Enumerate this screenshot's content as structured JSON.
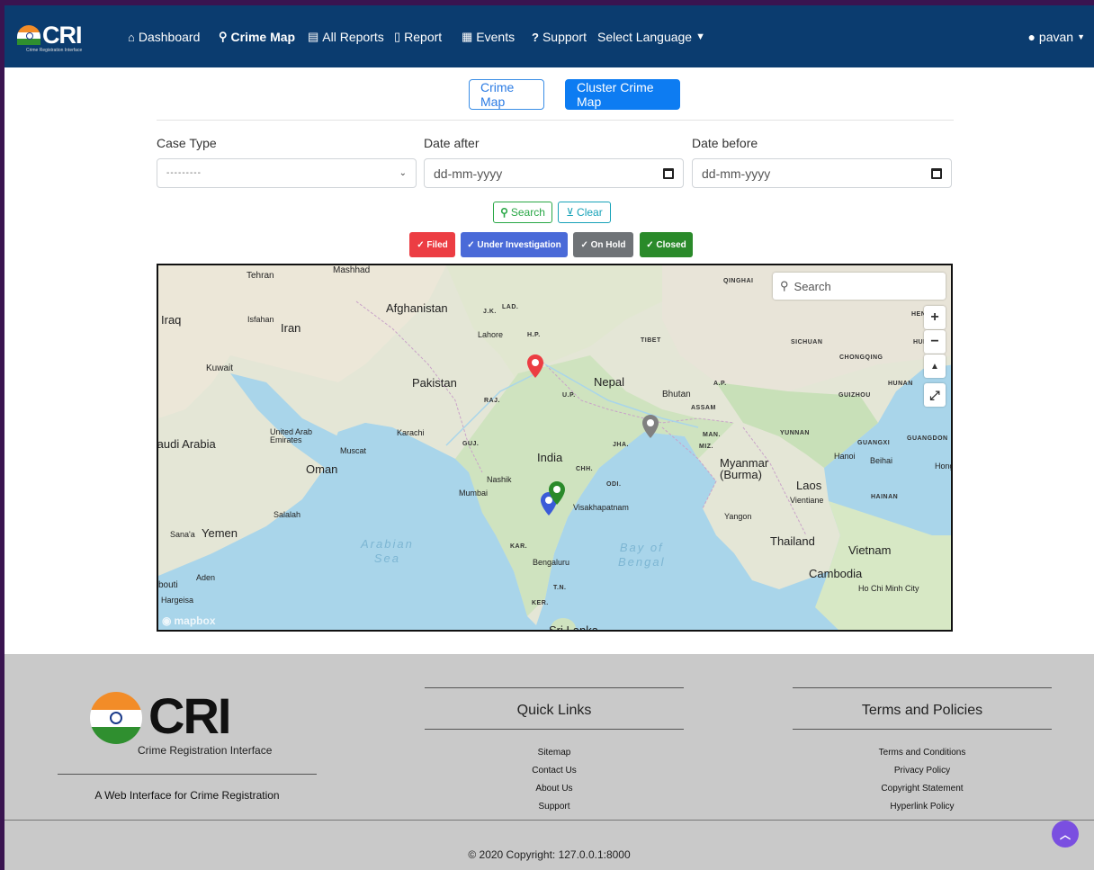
{
  "brand": {
    "name": "CRI",
    "subtitle": "Crime Registration Interface"
  },
  "nav": {
    "dashboard": "Dashboard",
    "crime_map": "Crime Map",
    "all_reports": "All Reports",
    "report": "Report",
    "events": "Events",
    "support": "Support",
    "language": "Select Language",
    "user": "pavan"
  },
  "toggle": {
    "crime_map": "Crime Map",
    "cluster_map": "Cluster Crime Map"
  },
  "filters": {
    "case_type_label": "Case Type",
    "case_type_value": "---------",
    "date_after_label": "Date after",
    "date_after_placeholder": "dd-mm-yyyy",
    "date_before_label": "Date before",
    "date_before_placeholder": "dd-mm-yyyy",
    "search_label": "Search",
    "clear_label": "Clear"
  },
  "status": {
    "filed": "✓ Filed",
    "under_investigation": "✓ Under Investigation",
    "on_hold": "✓ On Hold",
    "closed": "✓ Closed",
    "colors": {
      "filed": "#ec3d43",
      "under_investigation": "#4a6ad8",
      "on_hold": "#6f7377",
      "closed": "#2a8a2a"
    }
  },
  "map": {
    "search_placeholder": "Search",
    "attribution": "mapbox",
    "labels": {
      "tehran": "Tehran",
      "mashhad": "Mashhad",
      "afghanistan": "Afghanistan",
      "iraq": "Iraq",
      "isfahan": "Isfahan",
      "iran": "Iran",
      "kuwait": "Kuwait",
      "pakistan": "Pakistan",
      "nepal": "Nepal",
      "bhutan": "Bhutan",
      "saudi": "Saudi Arabia",
      "uae": "United Arab\nEmirates",
      "muscat": "Muscat",
      "oman": "Oman",
      "karachi": "Karachi",
      "india": "India",
      "lahore": "Lahore",
      "nashik": "Nashik",
      "mumbai": "Mumbai",
      "visakhapatnam": "Visakhapatnam",
      "salalah": "Salalah",
      "sanaa": "Sana'a",
      "yemen": "Yemen",
      "aden": "Aden",
      "hargeisa": "Hargeisa",
      "bouti": "bouti",
      "arabian_sea": "Arabian\nSea",
      "bay_of_bengal": "Bay of\nBengal",
      "bengaluru": "Bengaluru",
      "sri_lanka": "Sri Lanka",
      "myanmar": "Myanmar\n(Burma)",
      "yangon": "Yangon",
      "thailand": "Thailand",
      "laos": "Laos",
      "vientiane": "Vientiane",
      "vietnam": "Vietnam",
      "cambodia": "Cambodia",
      "hcm": "Ho Chi Minh City",
      "hanoi": "Hanoi",
      "qinghai": "QINGHAI",
      "sichuan": "SICHUAN",
      "chongqing": "CHONGQING",
      "hunan": "HUNAN",
      "guizhou": "GUIZHOU",
      "yunnan": "YUNNAN",
      "guangxi": "GUANGXI",
      "guangdong": "GUANGDON",
      "hainan": "HAINAN",
      "beihai": "Beihai",
      "hong": "Hong",
      "tibet": "TIBET",
      "hen": "HEN",
      "hube": "HUBE",
      "jk": "J.K.",
      "lad": "LAD.",
      "hp": "H.P.",
      "raj": "RAJ.",
      "up": "U.P.",
      "ap": "A.P.",
      "assam": "ASSAM",
      "man": "MAN.",
      "miz": "MIZ.",
      "guj": "GUJ.",
      "jha": "JHA.",
      "chh": "CHH.",
      "odi": "ODI.",
      "kar": "KAR.",
      "tn": "T.N.",
      "ker": "KER."
    }
  },
  "footer": {
    "logo_name": "CRI",
    "logo_tagline": "Crime Registration Interface",
    "description": "A Web Interface for Crime Registration",
    "quick_links_title": "Quick Links",
    "quick_links": [
      "Sitemap",
      "Contact Us",
      "About Us",
      "Support"
    ],
    "terms_title": "Terms and Policies",
    "terms_links": [
      "Terms and Conditions",
      "Privacy Policy",
      "Copyright Statement",
      "Hyperlink Policy"
    ],
    "copyright": "© 2020 Copyright:   127.0.0.1:8000"
  }
}
